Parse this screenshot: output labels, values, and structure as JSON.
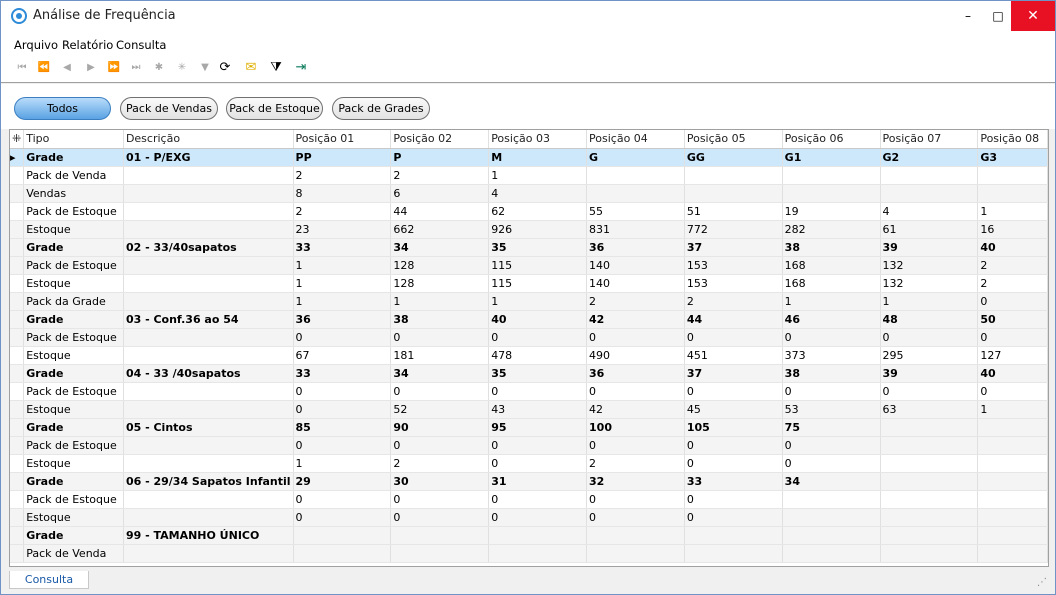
{
  "window": {
    "title": "Análise de Frequência",
    "min": "–",
    "max": "□",
    "close": "✕"
  },
  "menu": [
    "Arquivo",
    "Relatório",
    "Consulta"
  ],
  "toolbar": {
    "first": "⏮",
    "prev_page": "⏪",
    "prev": "◀",
    "next": "▶",
    "next_page": "⏩",
    "last": "⏭",
    "insert": "✱",
    "delete": "✳",
    "filter_small": "▼",
    "refresh": "⟳",
    "email": "✉",
    "filter": "⧩",
    "exit": "⇥"
  },
  "filters": {
    "todos": "Todos",
    "vendas": "Pack de Vendas",
    "estoque": "Pack de Estoque",
    "grades": "Pack de Grades"
  },
  "columns": [
    "Tipo",
    "Descrição",
    "Posição 01",
    "Posição 02",
    "Posição 03",
    "Posição 04",
    "Posição 05",
    "Posição 06",
    "Posição 07",
    "Posição 08"
  ],
  "rows": [
    [
      "Grade",
      "01 - P/EXG",
      "PP",
      "P",
      "M",
      "G",
      "GG",
      "G1",
      "G2",
      "G3"
    ],
    [
      "Pack de Venda",
      "",
      "2",
      "2",
      "1",
      "",
      "",
      "",
      "",
      ""
    ],
    [
      "Vendas",
      "",
      "8",
      "6",
      "4",
      "",
      "",
      "",
      "",
      ""
    ],
    [
      "Pack de Estoque",
      "",
      "2",
      "44",
      "62",
      "55",
      "51",
      "19",
      "4",
      "1"
    ],
    [
      "Estoque",
      "",
      "23",
      "662",
      "926",
      "831",
      "772",
      "282",
      "61",
      "16"
    ],
    [
      "Grade",
      "02 - 33/40sapatos",
      "33",
      "34",
      "35",
      "36",
      "37",
      "38",
      "39",
      "40"
    ],
    [
      "Pack de Estoque",
      "",
      "1",
      "128",
      "115",
      "140",
      "153",
      "168",
      "132",
      "2"
    ],
    [
      "Estoque",
      "",
      "1",
      "128",
      "115",
      "140",
      "153",
      "168",
      "132",
      "2"
    ],
    [
      "Pack da Grade",
      "",
      "1",
      "1",
      "1",
      "2",
      "2",
      "1",
      "1",
      "0"
    ],
    [
      "Grade",
      "03 - Conf.36 ao 54",
      "36",
      "38",
      "40",
      "42",
      "44",
      "46",
      "48",
      "50"
    ],
    [
      "Pack de Estoque",
      "",
      "0",
      "0",
      "0",
      "0",
      "0",
      "0",
      "0",
      "0"
    ],
    [
      "Estoque",
      "",
      "67",
      "181",
      "478",
      "490",
      "451",
      "373",
      "295",
      "127"
    ],
    [
      "Grade",
      "04 - 33 /40sapatos",
      "33",
      "34",
      "35",
      "36",
      "37",
      "38",
      "39",
      "40"
    ],
    [
      "Pack de Estoque",
      "",
      "0",
      "0",
      "0",
      "0",
      "0",
      "0",
      "0",
      "0"
    ],
    [
      "Estoque",
      "",
      "0",
      "52",
      "43",
      "42",
      "45",
      "53",
      "63",
      "1"
    ],
    [
      "Grade",
      "05 - Cintos",
      "85",
      "90",
      "95",
      "100",
      "105",
      "75",
      "",
      ""
    ],
    [
      "Pack de Estoque",
      "",
      "0",
      "0",
      "0",
      "0",
      "0",
      "0",
      "",
      ""
    ],
    [
      "Estoque",
      "",
      "1",
      "2",
      "0",
      "2",
      "0",
      "0",
      "",
      ""
    ],
    [
      "Grade",
      "06 - 29/34 Sapatos Infantil",
      "29",
      "30",
      "31",
      "32",
      "33",
      "34",
      "",
      ""
    ],
    [
      "Pack de Estoque",
      "",
      "0",
      "0",
      "0",
      "0",
      "0",
      "",
      "",
      ""
    ],
    [
      "Estoque",
      "",
      "0",
      "0",
      "0",
      "0",
      "0",
      "",
      "",
      ""
    ],
    [
      "Grade",
      "99 - TAMANHO ÚNICO",
      "",
      "",
      "",
      "",
      "",
      "",
      "",
      ""
    ],
    [
      "Pack de Venda",
      "",
      "",
      "",
      "",
      "",
      "",
      "",
      "",
      ""
    ]
  ],
  "status": {
    "tab": "Consulta"
  }
}
